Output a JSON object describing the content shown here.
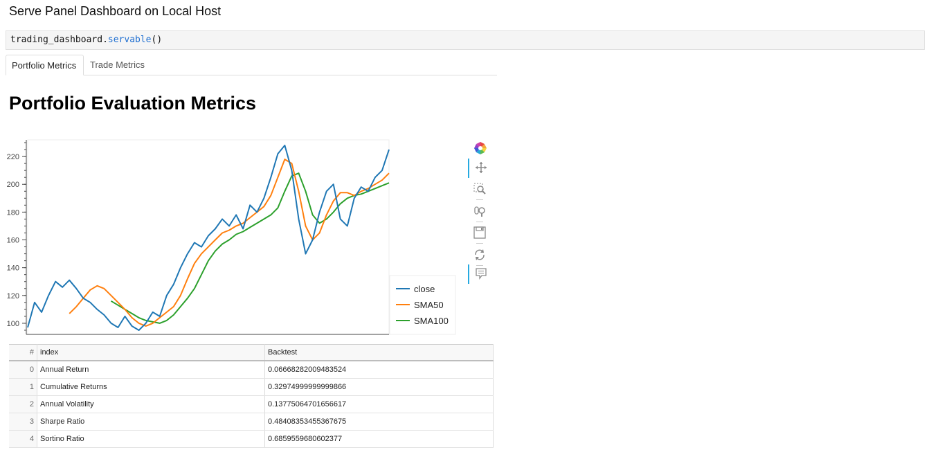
{
  "page": {
    "heading": "Serve Panel Dashboard on Local Host",
    "code": {
      "object": "trading_dashboard",
      "dot": ".",
      "method": "servable",
      "parens": "()"
    },
    "tabs": [
      {
        "label": "Portfolio Metrics",
        "active": true
      },
      {
        "label": "Trade Metrics",
        "active": false
      }
    ],
    "title": "Portfolio Evaluation Metrics"
  },
  "toolbar": {
    "tools": [
      "bokeh-logo",
      "pan",
      "box-zoom",
      "wheel-zoom",
      "save",
      "reset",
      "hover"
    ]
  },
  "chart_data": {
    "type": "line",
    "x": [
      0,
      10,
      20,
      30,
      40,
      50,
      60,
      70,
      80,
      90,
      100,
      110,
      120,
      130,
      140,
      150,
      160,
      170,
      180,
      190,
      200,
      210,
      220,
      230,
      240,
      250,
      260,
      270,
      280,
      290,
      300,
      310,
      320,
      330,
      340,
      350,
      360,
      370,
      380,
      390,
      400,
      410,
      420,
      430,
      440,
      450,
      460,
      470,
      480,
      490,
      500,
      510,
      520
    ],
    "xlim": [
      0,
      520
    ],
    "ylim": [
      92,
      232
    ],
    "yticks": [
      100,
      120,
      140,
      160,
      180,
      200,
      220
    ],
    "xlabel": "",
    "ylabel": "",
    "legend_position": "bottom-right",
    "series": [
      {
        "name": "close",
        "color": "#1f77b4",
        "values": [
          97,
          115,
          108,
          120,
          130,
          126,
          131,
          125,
          118,
          115,
          110,
          106,
          100,
          97,
          105,
          98,
          95,
          100,
          108,
          105,
          120,
          128,
          140,
          150,
          158,
          155,
          163,
          168,
          175,
          170,
          178,
          168,
          185,
          180,
          190,
          205,
          222,
          228,
          210,
          175,
          150,
          160,
          180,
          195,
          200,
          175,
          170,
          190,
          198,
          195,
          205,
          210,
          225
        ]
      },
      {
        "name": "SMA50",
        "color": "#ff7f0e",
        "values": [
          null,
          null,
          null,
          null,
          null,
          null,
          107,
          112,
          118,
          124,
          127,
          125,
          120,
          115,
          110,
          104,
          100,
          98,
          100,
          104,
          108,
          112,
          120,
          132,
          143,
          150,
          155,
          160,
          165,
          167,
          170,
          172,
          176,
          180,
          184,
          192,
          205,
          218,
          215,
          195,
          170,
          160,
          165,
          178,
          188,
          194,
          194,
          192,
          195,
          197,
          200,
          203,
          208
        ]
      },
      {
        "name": "SMA100",
        "color": "#2ca02c",
        "values": [
          null,
          null,
          null,
          null,
          null,
          null,
          null,
          null,
          null,
          null,
          null,
          null,
          116,
          113,
          110,
          107,
          104,
          102,
          101,
          100,
          102,
          106,
          112,
          118,
          125,
          135,
          145,
          152,
          157,
          160,
          164,
          166,
          169,
          172,
          175,
          178,
          183,
          195,
          206,
          208,
          195,
          178,
          172,
          175,
          180,
          186,
          190,
          192,
          193,
          195,
          197,
          199,
          201
        ]
      }
    ]
  },
  "table": {
    "columns": [
      "#",
      "index",
      "Backtest"
    ],
    "rows": [
      {
        "idx": "0",
        "name": "Annual Return",
        "value": "0.06668282009483524"
      },
      {
        "idx": "1",
        "name": "Cumulative Returns",
        "value": "0.32974999999999866"
      },
      {
        "idx": "2",
        "name": "Annual Volatility",
        "value": "0.13775064701656617"
      },
      {
        "idx": "3",
        "name": "Sharpe Ratio",
        "value": "0.48408353455367675"
      },
      {
        "idx": "4",
        "name": "Sortino Ratio",
        "value": "0.6859559680602377"
      }
    ]
  }
}
